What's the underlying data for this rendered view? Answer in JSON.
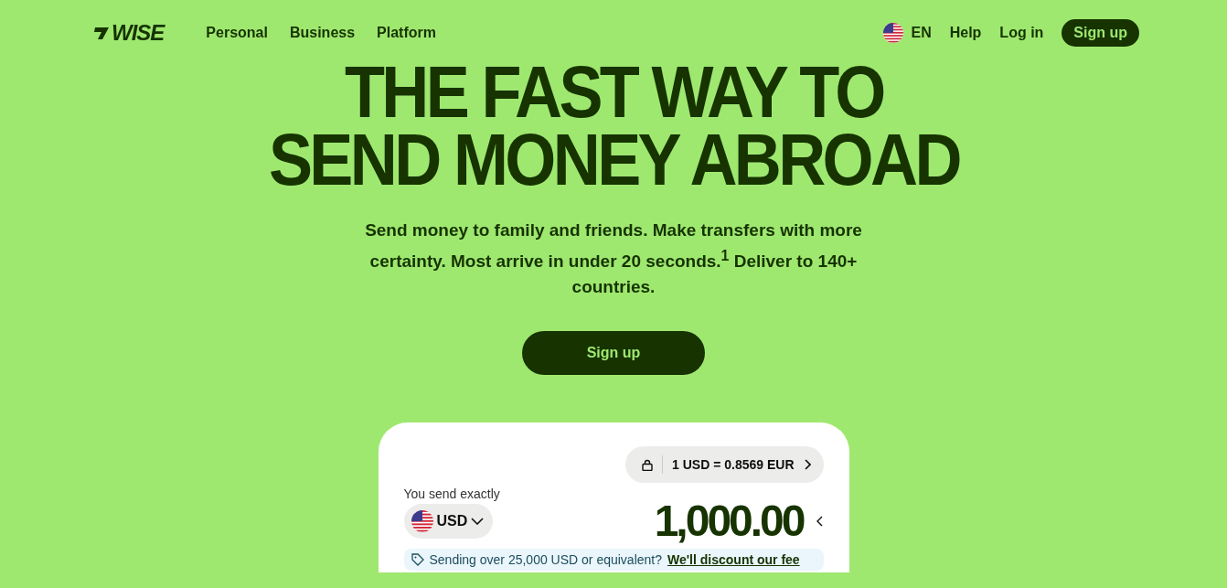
{
  "nav": {
    "logo": "WISE",
    "links": [
      {
        "label": "Personal"
      },
      {
        "label": "Business"
      },
      {
        "label": "Platform"
      }
    ],
    "language": "EN",
    "help": "Help",
    "login": "Log in",
    "signup": "Sign up"
  },
  "hero": {
    "title_lines": [
      "THE FAST WAY TO",
      "SEND MONEY ABROAD"
    ],
    "subtitle": "Send money to family and friends. Make transfers with more certainty. Most arrive in under 20 seconds.$^{1}$ Deliver to 140+ countries.",
    "cta": "Sign up"
  },
  "calculator": {
    "rate": "1 USD = 0.8569 EUR",
    "send_label": "You send exactly",
    "currency": "USD",
    "amount": "1,000.00",
    "notice": "Sending over 25,000 USD or equivalent?",
    "notice_link": "We'll discount our fee"
  }
}
